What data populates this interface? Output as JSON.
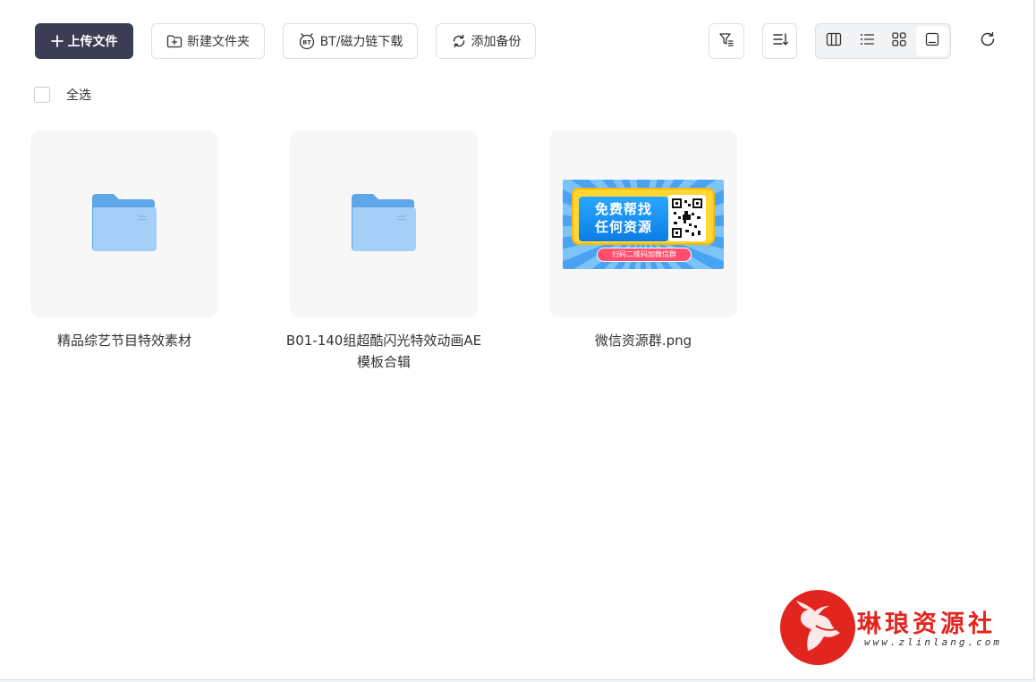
{
  "toolbar": {
    "upload_label": "上传文件",
    "new_folder_label": "新建文件夹",
    "bt_label": "BT/磁力链下载",
    "backup_label": "添加备份"
  },
  "select_all_label": "全选",
  "files": [
    {
      "name": "精品综艺节目特效素材",
      "type": "folder"
    },
    {
      "name": "B01-140组超酷闪光特效动画AE模板合辑",
      "type": "folder"
    },
    {
      "name": "微信资源群.png",
      "type": "image"
    }
  ],
  "promo": {
    "line1": "免费帮找",
    "line2": "任何资源",
    "ribbon": "扫码二维码加微信群"
  },
  "watermark": {
    "name": "琳琅资源社",
    "url": "www.zlinlang.com"
  },
  "colors": {
    "primary": "#3a3d54",
    "folder": "#7fbaf0",
    "watermark": "#e2261f"
  }
}
